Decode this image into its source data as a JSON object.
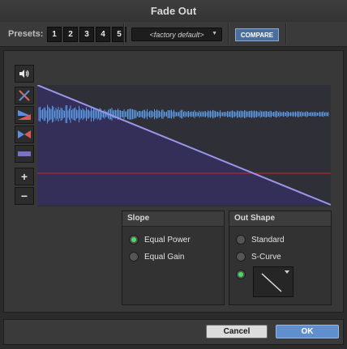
{
  "window": {
    "title": "Fade Out"
  },
  "presets": {
    "label": "Presets:",
    "buttons": [
      "1",
      "2",
      "3",
      "4",
      "5"
    ],
    "dropdown_value": "<factory default>",
    "compare_label": "COMPARE"
  },
  "toolbar": {
    "speaker": "speaker-icon",
    "zoom_in": "+",
    "zoom_out": "−"
  },
  "slope": {
    "title": "Slope",
    "options": [
      "Equal Power",
      "Equal Gain"
    ],
    "selected": "Equal Power"
  },
  "out_shape": {
    "title": "Out Shape",
    "options": [
      "Standard",
      "S-Curve"
    ],
    "selected": "custom-preset"
  },
  "footer": {
    "cancel_label": "Cancel",
    "ok_label": "OK"
  },
  "colors": {
    "accent": "#5f8fcc",
    "radio_on": "#43e05d",
    "fade_line": "#9a96e6",
    "waveform": "#5b9be6",
    "reference_line": "#c8282e",
    "graph_bg": "#2f2f38"
  }
}
